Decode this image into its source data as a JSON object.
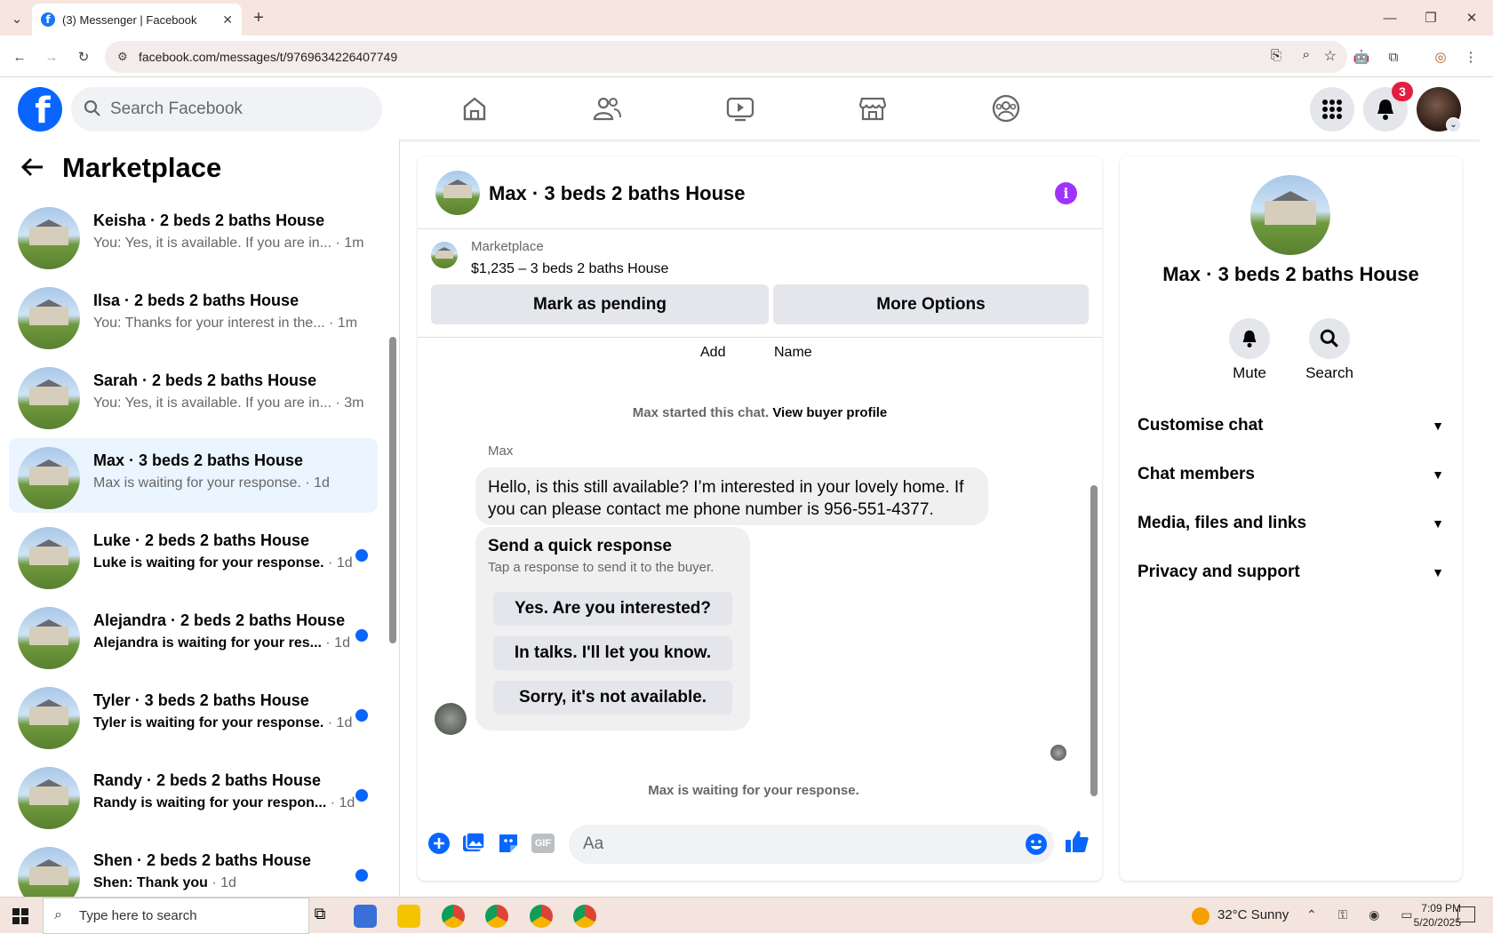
{
  "browser": {
    "tab_title": "(3) Messenger | Facebook",
    "url": "facebook.com/messages/t/9769634226407749"
  },
  "fb": {
    "search_placeholder": "Search Facebook",
    "notif_count": "3"
  },
  "left": {
    "title": "Marketplace",
    "conversations": [
      {
        "name": "Keisha · 2 beds 2 baths House",
        "preview": "You: Yes, it is available. If you are in...",
        "time": "1m",
        "unread": false,
        "selected": false
      },
      {
        "name": "Ilsa · 2 beds 2 baths House",
        "preview": "You: Thanks for your interest in the...",
        "time": "1m",
        "unread": false,
        "selected": false
      },
      {
        "name": "Sarah · 2 beds 2 baths House",
        "preview": "You: Yes, it is available. If you are in...",
        "time": "3m",
        "unread": false,
        "selected": false
      },
      {
        "name": "Max · 3 beds 2 baths House",
        "preview": "Max is waiting for your response.",
        "time": "1d",
        "unread": false,
        "selected": true
      },
      {
        "name": "Luke · 2 beds 2 baths House",
        "preview": "Luke is waiting for your response.",
        "time": "1d",
        "unread": true,
        "selected": false
      },
      {
        "name": "Alejandra · 2 beds 2 baths House",
        "preview": "Alejandra is waiting for your res...",
        "time": "1d",
        "unread": true,
        "selected": false
      },
      {
        "name": "Tyler · 3 beds 2 baths House",
        "preview": "Tyler is waiting for your response.",
        "time": "1d",
        "unread": true,
        "selected": false
      },
      {
        "name": "Randy · 2 beds 2 baths House",
        "preview": "Randy is waiting for your respon...",
        "time": "1d",
        "unread": true,
        "selected": false
      },
      {
        "name": "Shen · 2 beds 2 baths House",
        "preview": "Shen: Thank you",
        "time": "1d",
        "unread": true,
        "selected": false
      }
    ]
  },
  "chat": {
    "title": "Max · 3 beds 2 baths House",
    "listing_label": "Marketplace",
    "listing_price": "$1,235 – 3 beds 2 baths House",
    "mark_pending": "Mark as pending",
    "more_options": "More Options",
    "add_label": "Add",
    "name_label": "Name",
    "started_text": "Max started this chat.",
    "buyer_profile": "View buyer profile",
    "sender": "Max",
    "message": "Hello, is this still available? I’m interested in your lovely home. If you can please contact me phone number is 956-551-4377.",
    "quick_title": "Send a quick response",
    "quick_sub": "Tap a response to send it to the buyer.",
    "quick_replies": [
      "Yes. Are you interested?",
      "In talks. I'll let you know.",
      "Sorry, it's not available."
    ],
    "waiting": "Max is waiting for your response.",
    "input_placeholder": "Aa",
    "gif_label": "GIF"
  },
  "right": {
    "name": "Max · 3 beds 2 baths House",
    "mute": "Mute",
    "search": "Search",
    "sections": [
      "Customise chat",
      "Chat members",
      "Media, files and links",
      "Privacy and support"
    ]
  },
  "taskbar": {
    "search_placeholder": "Type here to search",
    "weather": "32°C  Sunny",
    "time": "7:09 PM",
    "date": "5/20/2025"
  },
  "colors": {
    "fb_blue": "#0866ff",
    "selected_bg": "#ebf5ff",
    "info_purple": "#a033ff"
  }
}
